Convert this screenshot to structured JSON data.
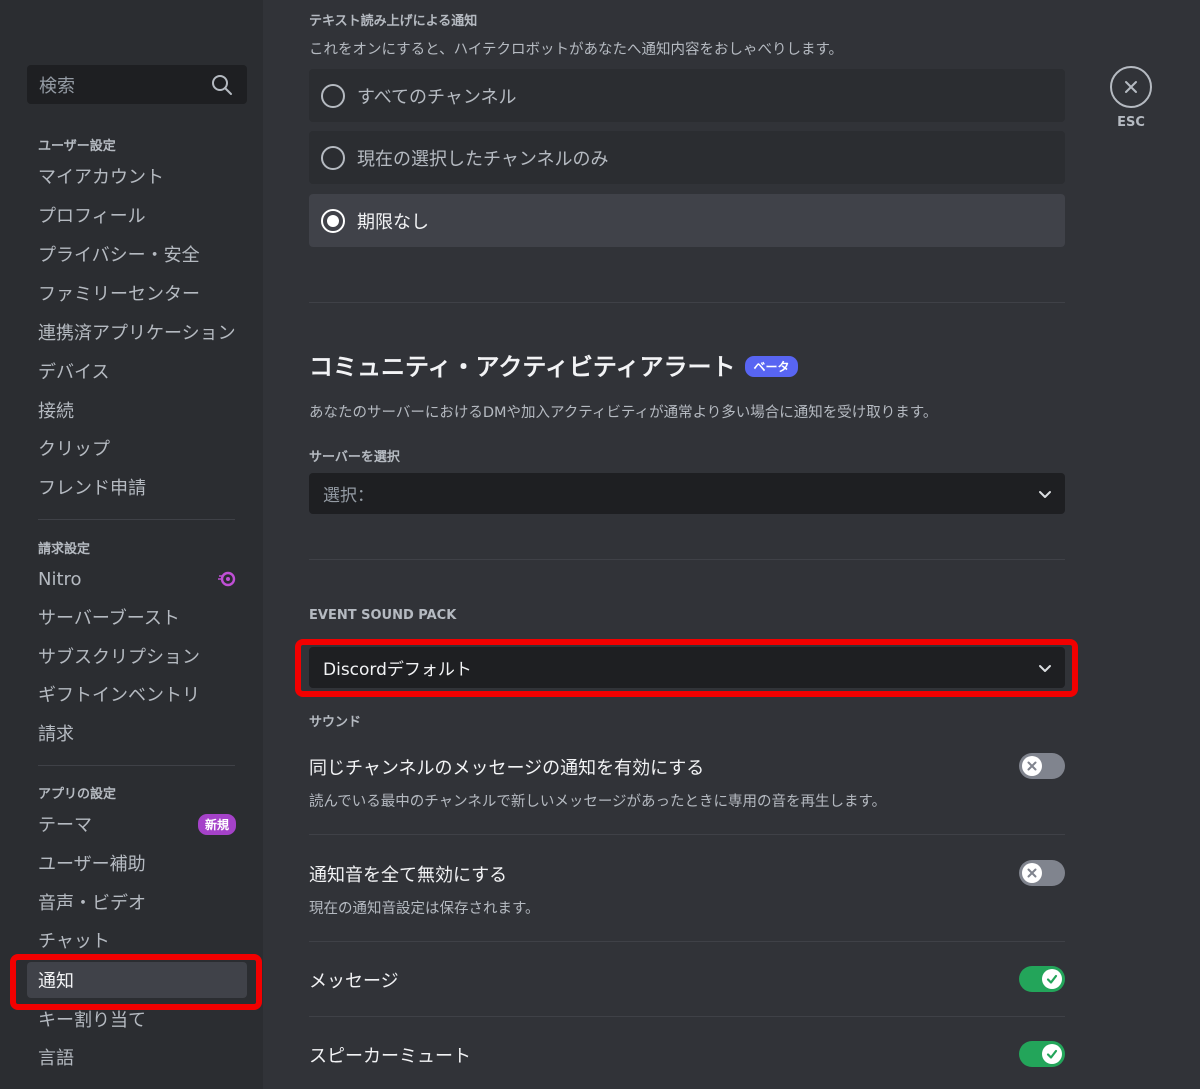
{
  "sidebar": {
    "search_placeholder": "検索",
    "sections": [
      {
        "header": "ユーザー設定",
        "items": [
          "マイアカウント",
          "プロフィール",
          "プライバシー・安全",
          "ファミリーセンター",
          "連携済アプリケーション",
          "デバイス",
          "接続",
          "クリップ",
          "フレンド申請"
        ]
      },
      {
        "header": "請求設定",
        "items": [
          "Nitro",
          "サーバーブースト",
          "サブスクリプション",
          "ギフトインベントリ",
          "請求"
        ]
      },
      {
        "header": "アプリの設定",
        "items": [
          "テーマ",
          "ユーザー補助",
          "音声・ビデオ",
          "チャット",
          "通知",
          "キー割り当て",
          "言語"
        ]
      }
    ],
    "new_badge": "新規",
    "selected_item": "通知"
  },
  "close": {
    "label": "ESC"
  },
  "tts": {
    "header": "テキスト読み上げによる通知",
    "description": "これをオンにすると、ハイテクロボットがあなたへ通知内容をおしゃべりします。",
    "options": [
      {
        "label": "すべてのチャンネル",
        "selected": false
      },
      {
        "label": "現在の選択したチャンネルのみ",
        "selected": false
      },
      {
        "label": "期限なし",
        "selected": true
      }
    ]
  },
  "community": {
    "title": "コミュニティ・アクティビティアラート",
    "badge": "ベータ",
    "description": "あなたのサーバーにおけるDMや加入アクティビティが通常より多い場合に通知を受け取ります。",
    "server_label": "サーバーを選択",
    "server_placeholder": "選択："
  },
  "sound_pack": {
    "header": "EVENT SOUND PACK",
    "value": "Discordデフォルト"
  },
  "sounds": {
    "header": "サウンド",
    "items": [
      {
        "title": "同じチャンネルのメッセージの通知を有効にする",
        "description": "読んでいる最中のチャンネルで新しいメッセージがあったときに専用の音を再生します。",
        "enabled": false
      },
      {
        "title": "通知音を全て無効にする",
        "description": "現在の通知音設定は保存されます。",
        "enabled": false
      },
      {
        "title": "メッセージ",
        "description": "",
        "enabled": true
      },
      {
        "title": "スピーカーミュート",
        "description": "",
        "enabled": true
      }
    ]
  },
  "colors": {
    "accent": "#5865f2",
    "toggle_on": "#23a55a",
    "toggle_off": "#80848e",
    "highlight": "#f20000"
  }
}
